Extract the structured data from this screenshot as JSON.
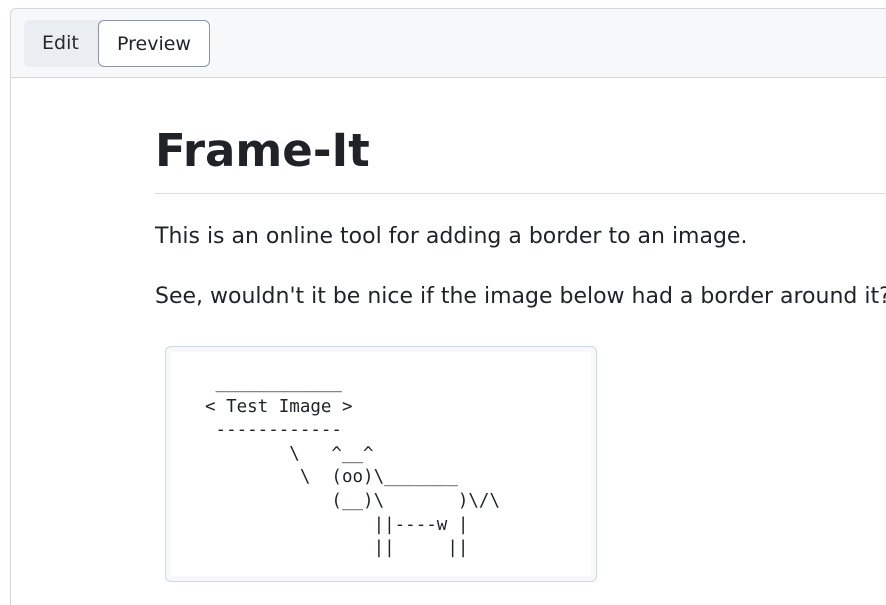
{
  "tabs": {
    "edit_label": "Edit",
    "preview_label": "Preview",
    "active": "Preview"
  },
  "document": {
    "title": "Frame-It",
    "paragraph1": "This is an online tool for adding a border to an image.",
    "paragraph2": "See, wouldn't it be nice if the image below had a border around it?",
    "ascii_art": " ____________\n< Test Image >\n ------------\n        \\   ^__^\n         \\  (oo)\\_______\n            (__)\\       )\\/\\\n                ||----w |\n                ||     ||"
  }
}
